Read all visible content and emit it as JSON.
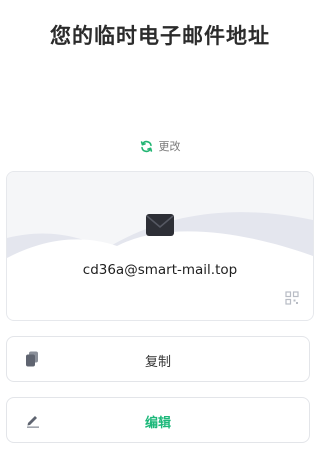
{
  "header": {
    "title": "您的临时电子邮件地址"
  },
  "change": {
    "label": "更改",
    "icon": "refresh-icon",
    "color": "#22b573"
  },
  "email": {
    "address": "cd36a@smart-mail.top",
    "icon": "envelope-icon",
    "qr_icon": "qr-code-icon"
  },
  "actions": {
    "copy_label": "复制",
    "copy_icon": "copy-icon",
    "edit_label": "编辑",
    "edit_icon": "pencil-icon",
    "edit_color": "#1db87a"
  }
}
